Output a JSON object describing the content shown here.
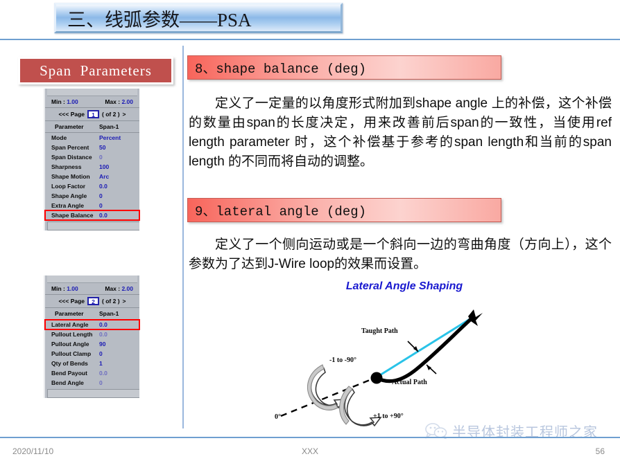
{
  "slide": {
    "title": "三、线弧参数——PSA"
  },
  "left_panel": {
    "box_label": "Span  Parameters",
    "panels": [
      {
        "min_label": "Min :",
        "min_value": "1.00",
        "max_label": "Max :",
        "max_value": "2.00",
        "prev_label": "<<< Page",
        "page_value": "1",
        "of_label": "( of 2 )",
        "next_label": ">",
        "header_left": "Parameter",
        "header_right": "Span-1",
        "rows": [
          {
            "key": "Mode",
            "value": "Percent",
            "dim": false,
            "highlight": false
          },
          {
            "key": "Span Percent",
            "value": "50",
            "dim": false,
            "highlight": false
          },
          {
            "key": "Span Distance",
            "value": "0",
            "dim": true,
            "highlight": false
          },
          {
            "key": "Sharpness",
            "value": "100",
            "dim": false,
            "highlight": false
          },
          {
            "key": "Shape Motion",
            "value": "Arc",
            "dim": false,
            "highlight": false
          },
          {
            "key": "Loop Factor",
            "value": "0.0",
            "dim": false,
            "highlight": false
          },
          {
            "key": "Shape Angle",
            "value": "0",
            "dim": false,
            "highlight": false
          },
          {
            "key": "Extra Angle",
            "value": "0",
            "dim": false,
            "highlight": false
          },
          {
            "key": "Shape Balance",
            "value": "0.0",
            "dim": false,
            "highlight": true
          }
        ]
      },
      {
        "min_label": "Min :",
        "min_value": "1.00",
        "max_label": "Max :",
        "max_value": "2.00",
        "prev_label": "<<< Page",
        "page_value": "2",
        "of_label": "( of 2 )",
        "next_label": ">",
        "header_left": "Parameter",
        "header_right": "Span-1",
        "rows": [
          {
            "key": "Lateral Angle",
            "value": "0.0",
            "dim": false,
            "highlight": true
          },
          {
            "key": "Pullout Length",
            "value": "0.0",
            "dim": true,
            "highlight": false
          },
          {
            "key": "Pullout Angle",
            "value": "90",
            "dim": false,
            "highlight": false
          },
          {
            "key": "Pullout Clamp",
            "value": "0",
            "dim": false,
            "highlight": false
          },
          {
            "key": "Qty of Bends",
            "value": "1",
            "dim": false,
            "highlight": false
          },
          {
            "key": "Bend Payout",
            "value": "0.0",
            "dim": true,
            "highlight": false
          },
          {
            "key": "Bend Angle",
            "value": "0",
            "dim": true,
            "highlight": false
          }
        ]
      }
    ]
  },
  "sections": [
    {
      "heading": "8、shape balance (deg)",
      "body": "定义了一定量的以角度形式附加到shape angle 上的补偿，这个补偿的数量由span的长度决定，用来改善前后span的一致性，当使用ref length parameter 时，这个补偿基于参考的span length和当前的span length 的不同而将自动的调整。"
    },
    {
      "heading": "9、lateral angle (deg)",
      "body": "定义了一个侧向运动或是一个斜向一边的弯曲角度（方向上），这个参数为了达到J-Wire loop的效果而设置。"
    }
  ],
  "diagram": {
    "title": "Lateral Angle Shaping",
    "labels": {
      "taught_path": "Taught Path",
      "actual_path": "Actual Path",
      "negative_range": "-1 to -90°",
      "positive_range": "+1 to +90°",
      "zero": "0°"
    },
    "colors": {
      "taught_path": "#29c3e8",
      "actual_path": "#000000",
      "title": "#1919cf"
    }
  },
  "footer": {
    "date": "2020/11/10",
    "center": "XXX",
    "page": "56",
    "watermark": "半导体封装工程师之家"
  },
  "colors": {
    "accent_blue": "#6f9fd0",
    "brick_red": "#c0504d",
    "heading_red": "#f8655b",
    "value_blue": "#1a1ab4",
    "highlight_red": "#ff0000"
  }
}
